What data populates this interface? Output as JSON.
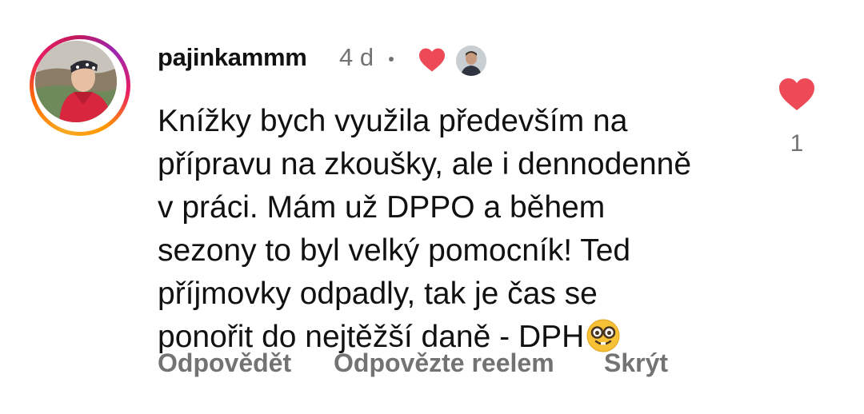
{
  "comment": {
    "username": "pajinkammm",
    "timestamp": "4 d",
    "liked_by_creator_icon": "heart-icon",
    "text_lines": [
      "Knížky bych využila především na",
      "přípravu na zkoušky, ale i dennodenně",
      "v práci. Mám už DPPO a během",
      "sezony to byl velký pomocník! Ted",
      "příjmovky odpadly, tak je čas se",
      "ponořit do nejtěžší daně - DPH"
    ],
    "emoji": "nerd-face-emoji",
    "like_count": "1",
    "like_icon": "heart-filled-icon",
    "actions": {
      "reply": "Odpovědět",
      "reply_with_reel": "Odpovězte reelem",
      "hide": "Skrýt"
    }
  },
  "colors": {
    "heart": "#ed4956",
    "muted": "#737373",
    "text": "#111111"
  }
}
